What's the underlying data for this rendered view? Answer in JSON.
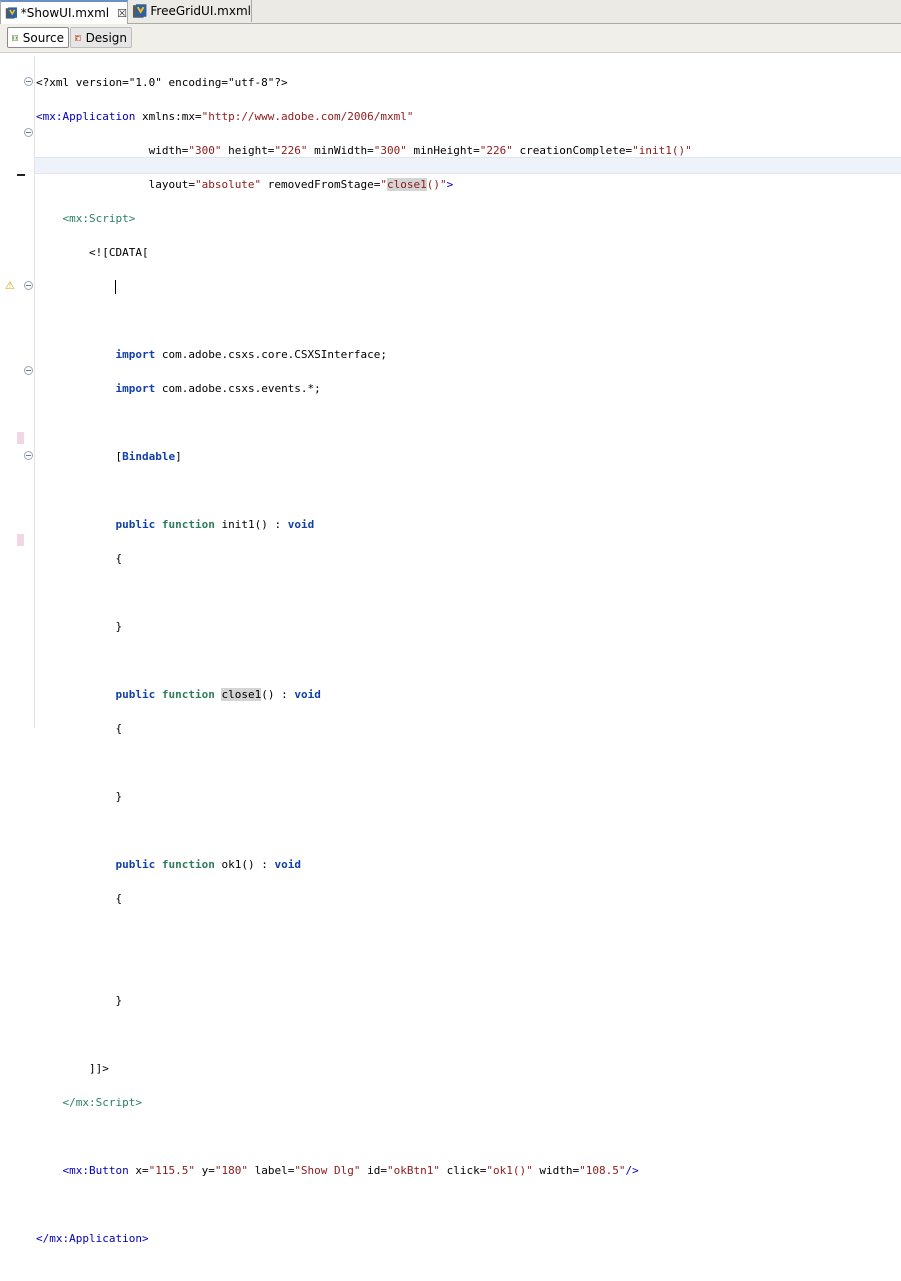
{
  "tabs": [
    {
      "label": "*ShowUI.mxml",
      "active": true,
      "icon": "mxml-file-icon",
      "close": "☒"
    },
    {
      "label": "FreeGridUI.mxml",
      "active": false,
      "icon": "mxml-file-icon"
    }
  ],
  "toolbar": {
    "source_label": "Source",
    "design_label": "Design"
  },
  "code": {
    "xml_decl": "<?xml version=\"1.0\" encoding=\"utf-8\"?>",
    "app_open": "<mx:Application",
    "xmlns_attr": " xmlns:mx=",
    "xmlns_val": "\"http://www.adobe.com/2006/mxml\"",
    "width_attr": "                 width=",
    "width_val": "\"300\"",
    "height_attr": " height=",
    "height_val": "\"226\"",
    "minwidth_attr": " minWidth=",
    "minwidth_val": "\"300\"",
    "minheight_attr": " minHeight=",
    "minheight_val": "\"226\"",
    "cc_attr": " creationComplete=",
    "cc_val": "\"init1()\"",
    "layout_attr": "                 layout=",
    "layout_val": "\"absolute\"",
    "rfs_attr": " removedFromStage=",
    "rfs_q": "\"",
    "rfs_hl": "close1",
    "rfs_rest": "()\"",
    "app_gt": ">",
    "script_open": "    <mx:Script>",
    "cdata_open": "        <![CDATA[",
    "import1_kw": "import",
    "import1_rest": " com.adobe.csxs.core.CSXSInterface;",
    "import2_kw": "import",
    "import2_rest": " com.adobe.csxs.events.*;",
    "bindable_open": "[",
    "bindable_kw": "Bindable",
    "bindable_close": "]",
    "public_kw": "public",
    "function_kw": "function",
    "void_kw": "void",
    "init_name": " init1() : ",
    "close_name": "close1",
    "close_rest": "() : ",
    "ok_name": " ok1() : ",
    "brace_open": "{",
    "brace_close": "}",
    "cdata_close": "        ]]>",
    "script_close": "    </mx:Script>",
    "button_open": "    <mx:Button",
    "btn_x_attr": " x=",
    "btn_x_val": "\"115.5\"",
    "btn_y_attr": " y=",
    "btn_y_val": "\"180\"",
    "btn_label_attr": " label=",
    "btn_label_val": "\"Show Dlg\"",
    "btn_id_attr": " id=",
    "btn_id_val": "\"okBtn1\"",
    "btn_click_attr": " click=",
    "btn_click_val": "\"ok1()\"",
    "btn_width_attr": " width=",
    "btn_width_val": "\"108.5\"",
    "btn_end": "/>",
    "app_close": "</mx:Application>"
  },
  "colors": {
    "tag": "#0000c0",
    "script_tag": "#2a7f62",
    "string": "#8b1a1a",
    "keyword": "#1140a9",
    "function_kw": "#2f7d5a"
  }
}
